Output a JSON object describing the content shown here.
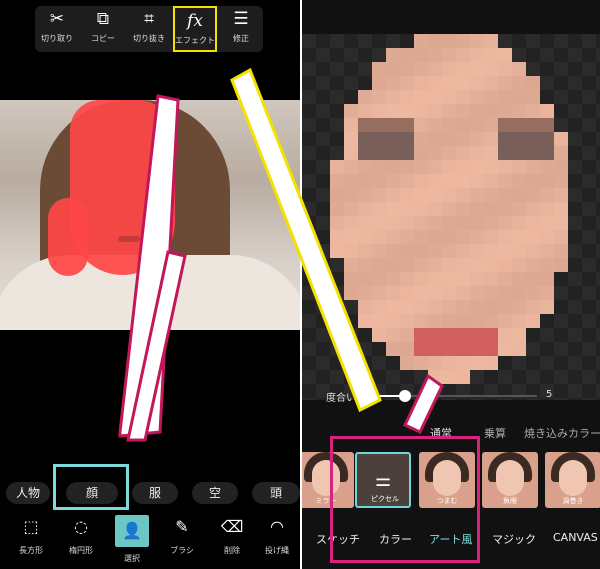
{
  "left": {
    "top_tools": [
      {
        "name": "cutout",
        "label": "切り取り",
        "icon": "scissors-icon",
        "glyph": "✂"
      },
      {
        "name": "copy",
        "label": "コピー",
        "icon": "copy-icon",
        "glyph": "⧉"
      },
      {
        "name": "crop",
        "label": "切り抜き",
        "icon": "crop-icon",
        "glyph": "⌗"
      },
      {
        "name": "effect",
        "label": "エフェクト",
        "icon": "fx-icon",
        "glyph": "fx"
      },
      {
        "name": "adjust",
        "label": "修正",
        "icon": "adjust-icon",
        "glyph": "☰"
      }
    ],
    "chips": [
      "人物",
      "顔",
      "服",
      "空",
      "頭"
    ],
    "bottom_tools": [
      {
        "label": "長方形",
        "icon": "rectangle-select-icon",
        "glyph": "⬚"
      },
      {
        "label": "楕円形",
        "icon": "ellipse-select-icon",
        "glyph": "◌"
      },
      {
        "label": "選択",
        "icon": "person-select-icon",
        "glyph": "👤"
      },
      {
        "label": "ブラシ",
        "icon": "brush-icon",
        "glyph": "✎"
      },
      {
        "label": "削除",
        "icon": "eraser-icon",
        "glyph": "⌫"
      },
      {
        "label": "投げ縄",
        "icon": "lasso-icon",
        "glyph": "◠"
      }
    ]
  },
  "right": {
    "slider": {
      "label": "度合い",
      "value": "5",
      "level": 0.2
    },
    "blend_modes": [
      "通常",
      "乗算",
      "焼き込みカラー"
    ],
    "thumbnails": [
      "ミラー",
      "ピクセル",
      "つまむ",
      "魚眼",
      "渦巻き"
    ],
    "categories": [
      "スケッチ",
      "カラー",
      "アート風",
      "マジック",
      "CANVAS"
    ]
  },
  "colors": {
    "highlight_yellow": "#f3e100",
    "highlight_cyan": "#7ed9dd",
    "highlight_pink": "#d8237c",
    "mask_red": "#ff4646",
    "accent_teal": "#7fe3df"
  }
}
